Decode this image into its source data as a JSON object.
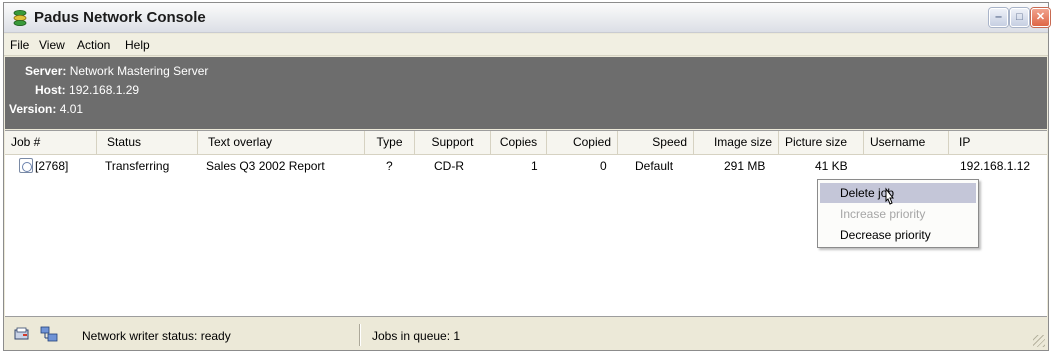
{
  "window": {
    "title": "Padus Network Console"
  },
  "titlebar": {
    "minimize": "‒",
    "maximize": "□",
    "close": "✕"
  },
  "menu": [
    "File",
    "View",
    "Action",
    "Help"
  ],
  "server_info": {
    "server_label": "Server:",
    "server_value": "Network Mastering Server",
    "host_label": "Host:",
    "host_value": "192.168.1.29",
    "version_label": "Version:",
    "version_value": "4.01"
  },
  "columns": [
    "Job #",
    "Status",
    "Text overlay",
    "Type",
    "Support",
    "Copies",
    "Copied",
    "Speed",
    "Image size",
    "Picture size",
    "Username",
    "IP"
  ],
  "jobs": [
    {
      "job": "[2768]",
      "status": "Transferring",
      "text_overlay": "Sales Q3 2002 Report",
      "type": "?",
      "support": "CD-R",
      "copies": "1",
      "copied": "0",
      "speed": "Default",
      "image_size": "291 MB",
      "picture_size": "41 KB",
      "username": "",
      "ip": "192.168.1.12"
    }
  ],
  "context_menu": {
    "items": [
      "Delete job",
      "Increase priority",
      "Decrease priority"
    ],
    "highlighted": "Delete job",
    "disabled": "Increase priority"
  },
  "statusbar": {
    "writer_status": "Network writer status: ready",
    "queue": "Jobs in queue: 1"
  },
  "colors": {
    "info_panel": "#6d6d6d",
    "highlight": "#c4c6d8",
    "window_bg": "#ece9d8"
  }
}
